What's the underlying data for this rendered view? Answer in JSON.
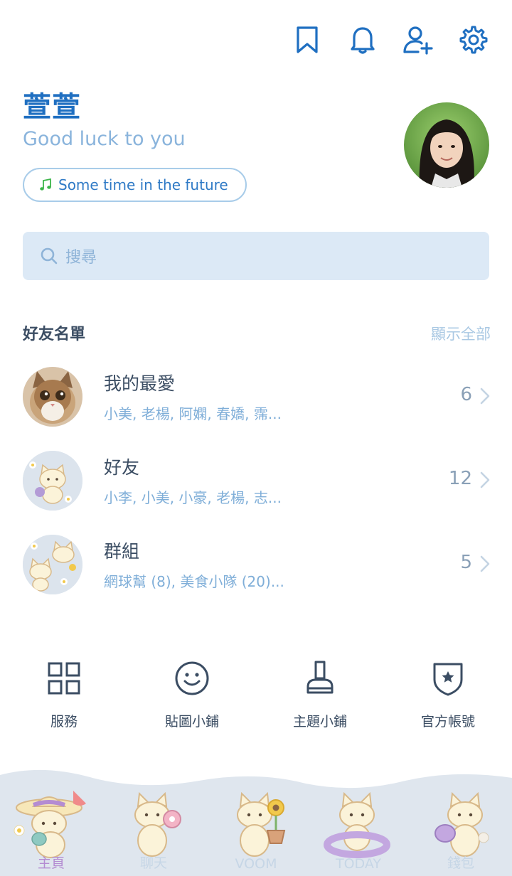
{
  "topbar": {
    "icons": [
      "bookmark-icon",
      "bell-icon",
      "add-friend-icon",
      "gear-icon"
    ],
    "color": "#1f6fc1"
  },
  "profile": {
    "name": "萱萱",
    "status": "Good luck to you",
    "music": "Some time in the future"
  },
  "search": {
    "placeholder": "搜尋"
  },
  "friends_section": {
    "title": "好友名單",
    "more": "顯示全部",
    "rows": [
      {
        "title": "我的最愛",
        "subtitle": "小美, 老楊, 阿嫻, 春嬌, 霈...",
        "count": "6"
      },
      {
        "title": "好友",
        "subtitle": "小李, 小美, 小豪, 老楊, 志...",
        "count": "12"
      },
      {
        "title": "群組",
        "subtitle": "網球幫 (8), 美食小隊 (20)...",
        "count": "5"
      }
    ]
  },
  "services": [
    {
      "label": "服務",
      "icon": "grid-icon"
    },
    {
      "label": "貼圖小鋪",
      "icon": "smiley-icon"
    },
    {
      "label": "主題小鋪",
      "icon": "brush-icon"
    },
    {
      "label": "官方帳號",
      "icon": "shield-star-icon"
    }
  ],
  "tabs": [
    {
      "label": "主頁",
      "active": true
    },
    {
      "label": "聊天",
      "active": false
    },
    {
      "label": "VOOM",
      "active": false
    },
    {
      "label": "TODAY",
      "active": false
    },
    {
      "label": "錢包",
      "active": false
    }
  ],
  "colors": {
    "accent": "#1f6fc1",
    "status_text": "#8ab4dc",
    "search_bg": "#dce9f6",
    "active_tab": "#b48cd2"
  }
}
